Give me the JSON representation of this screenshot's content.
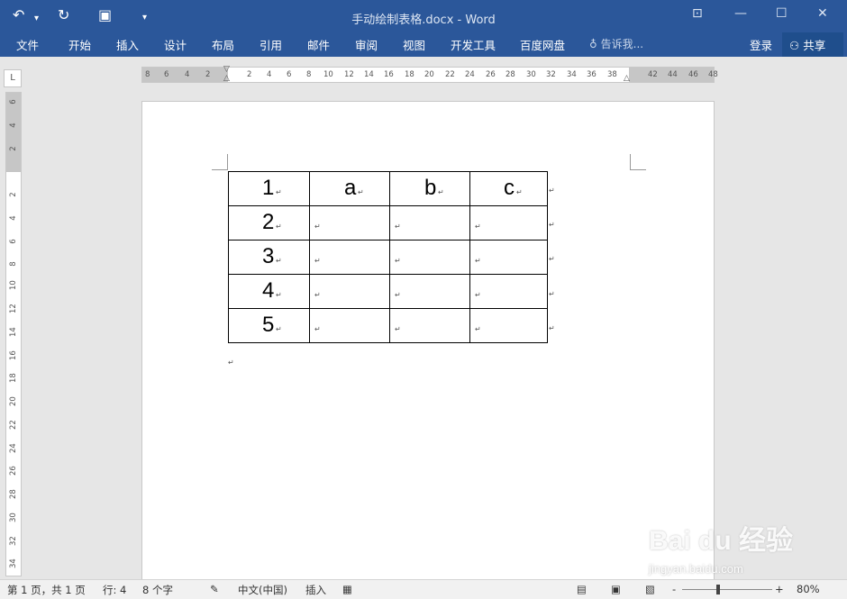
{
  "quick_access": {
    "undo_icon": "undo-icon",
    "redo_icon": "redo-icon",
    "save_icon": "save-icon",
    "customize_icon": "chevron-down-icon"
  },
  "window": {
    "title": "手动绘制表格.docx - Word"
  },
  "ribbon": {
    "tabs": [
      "文件",
      "开始",
      "插入",
      "设计",
      "布局",
      "引用",
      "邮件",
      "审阅",
      "视图",
      "开发工具",
      "百度网盘"
    ],
    "tell_me": "告诉我...",
    "login": "登录",
    "share": "共享"
  },
  "ruler": {
    "h_ticks": [
      "8",
      "6",
      "4",
      "2",
      "2",
      "4",
      "6",
      "8",
      "10",
      "12",
      "14",
      "16",
      "18",
      "20",
      "22",
      "24",
      "26",
      "28",
      "30",
      "32",
      "34",
      "36",
      "38",
      "42",
      "44",
      "46",
      "48"
    ],
    "v_ticks": [
      "6",
      "4",
      "2",
      "2",
      "4",
      "6",
      "8",
      "10",
      "12",
      "14",
      "16",
      "18",
      "20",
      "22",
      "24",
      "26",
      "28",
      "30",
      "32",
      "34"
    ],
    "corner_label": "L"
  },
  "table": {
    "rows": [
      [
        "1",
        "a",
        "b",
        "c"
      ],
      [
        "2",
        "",
        "",
        ""
      ],
      [
        "3",
        "",
        "",
        ""
      ],
      [
        "4",
        "",
        "",
        ""
      ],
      [
        "5",
        "",
        "",
        ""
      ]
    ],
    "paragraph_mark": "↵"
  },
  "status": {
    "page": "第 1 页，共 1 页",
    "line": "行: 4",
    "words": "8 个字",
    "language": "中文(中国)",
    "mode": "插入",
    "zoom": "80%",
    "zoom_minus": "-",
    "zoom_plus": "+"
  },
  "watermark": {
    "text": "Bai du 经验",
    "url": "jingyan.baidu.com"
  }
}
